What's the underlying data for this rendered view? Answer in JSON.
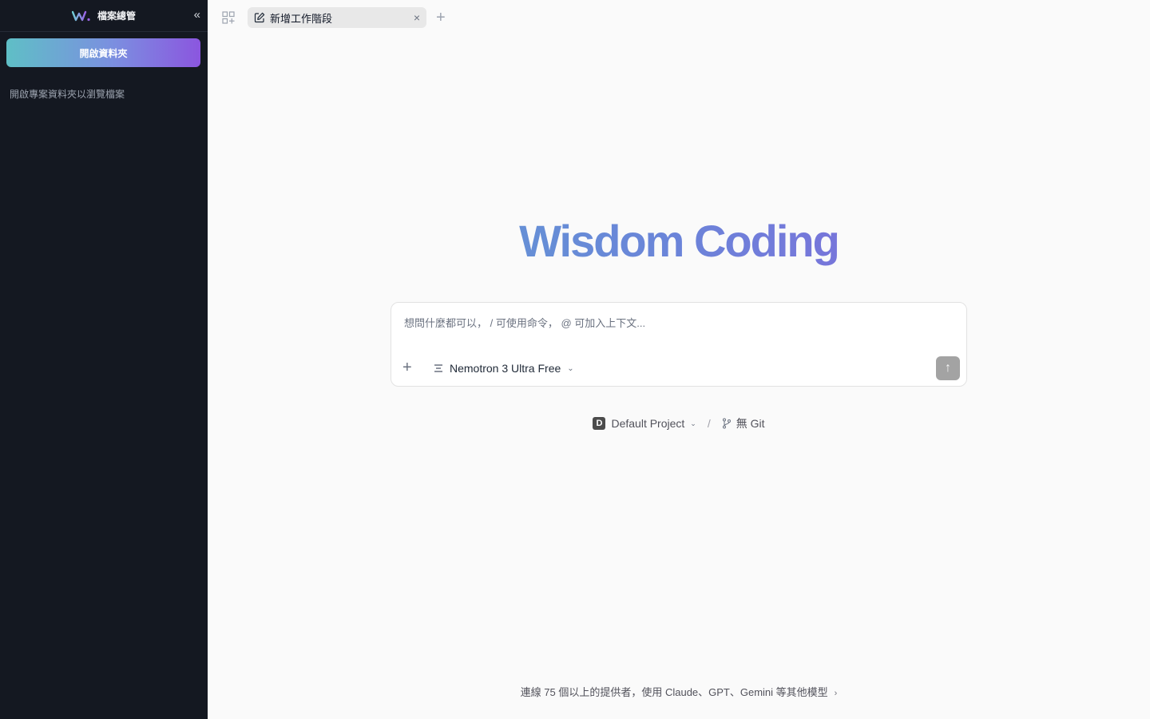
{
  "sidebar": {
    "title": "檔案總管",
    "logo_icon": "wisdom-logo-icon",
    "collapse_glyph": "«",
    "open_folder_label": "開啟資料夾",
    "hint": "開啟專案資料夾以瀏覽檔案"
  },
  "tabs": {
    "items": [
      {
        "label": "新增工作階段",
        "icon": "edit-icon",
        "close_glyph": "×"
      }
    ],
    "new_tab_glyph": "+"
  },
  "hero": {
    "title": "Wisdom Coding"
  },
  "composer": {
    "placeholder": "想問什麼都可以， / 可使用命令， @ 可加入上下文...",
    "attach_glyph": "+",
    "model": "Nemotron 3 Ultra Free",
    "send_glyph": "↑"
  },
  "project": {
    "badge": "D",
    "name": "Default Project",
    "separator": "/",
    "git": "無 Git"
  },
  "footer": {
    "text": "連線 75 個以上的提供者，使用 Claude、GPT、Gemini 等其他模型",
    "chevron": "›"
  },
  "colors": {
    "sidebar_bg": "#141821",
    "accent_start": "#5fbfc6",
    "accent_end": "#8b56df",
    "main_bg": "#fafafa"
  }
}
